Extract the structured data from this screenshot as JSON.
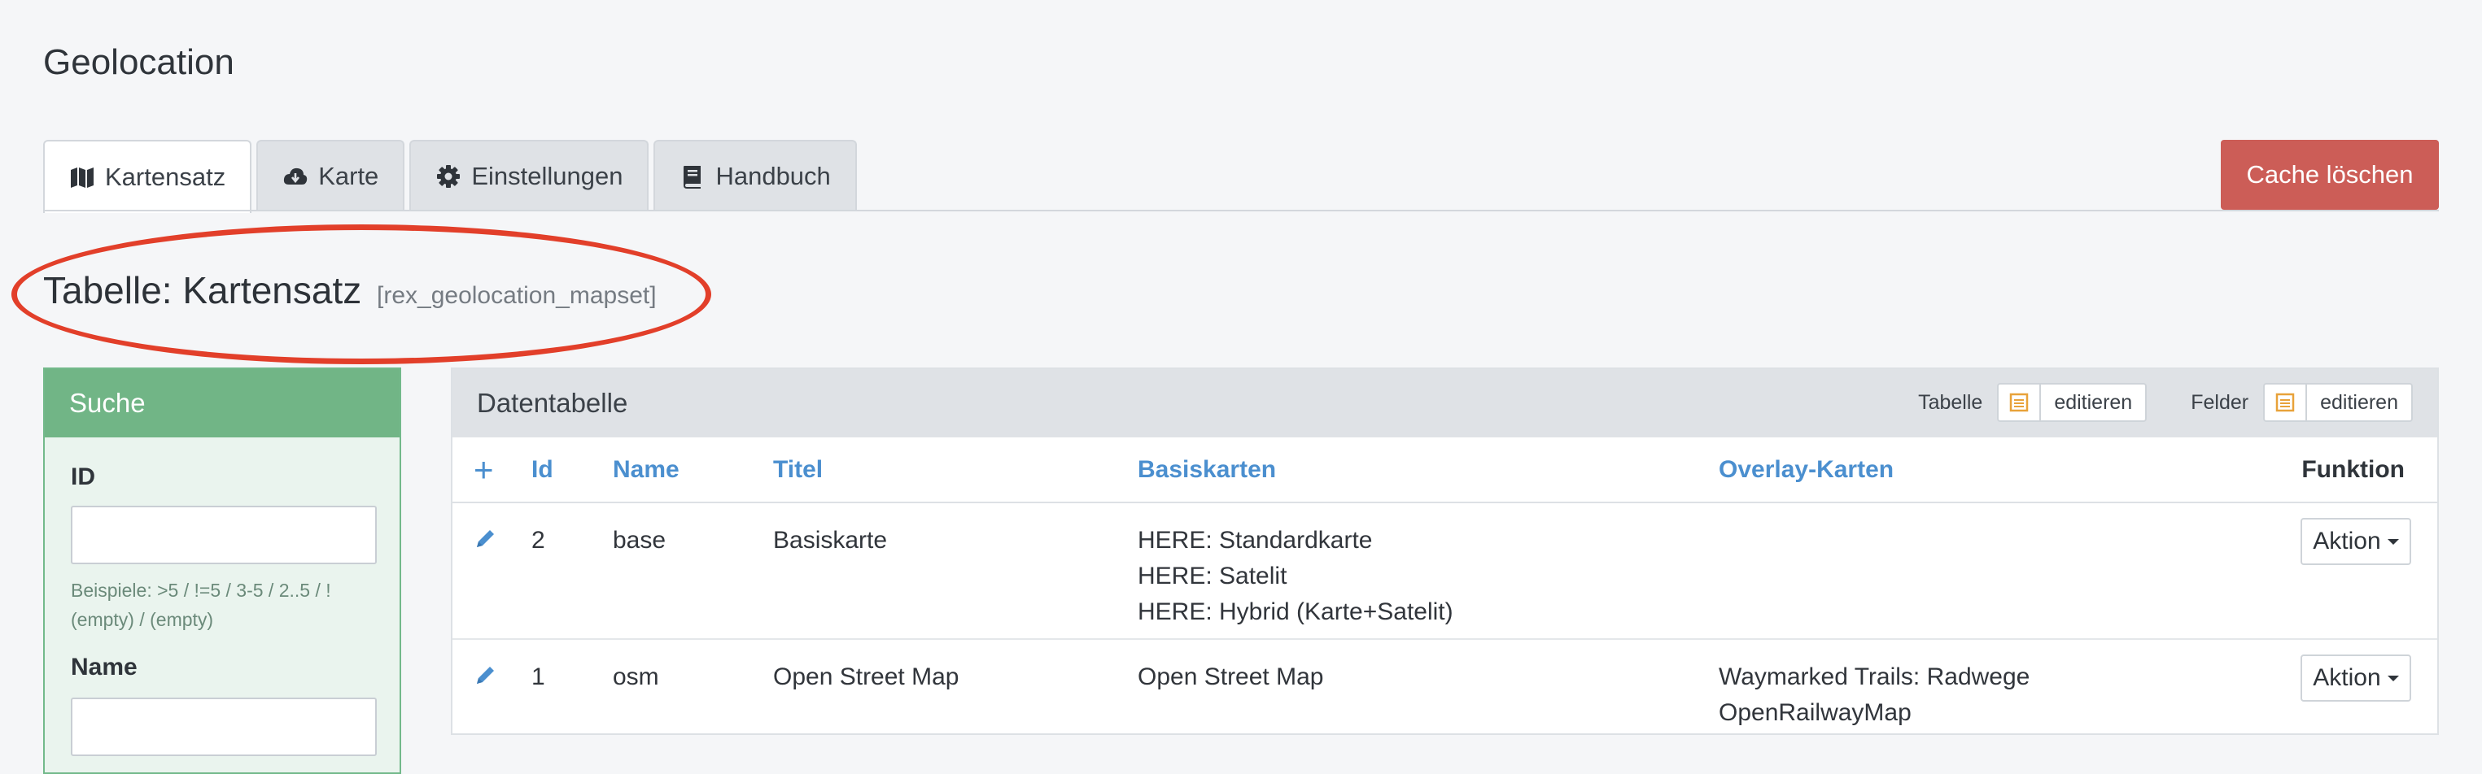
{
  "page": {
    "title": "Geolocation"
  },
  "tabs": [
    {
      "label": "Kartensatz",
      "icon": "map-icon",
      "active": true
    },
    {
      "label": "Karte",
      "icon": "cloud-download-icon",
      "active": false
    },
    {
      "label": "Einstellungen",
      "icon": "gear-icon",
      "active": false
    },
    {
      "label": "Handbuch",
      "icon": "book-icon",
      "active": false
    }
  ],
  "cache_button": {
    "label": "Cache löschen",
    "color": "#cc5d57"
  },
  "table_heading": {
    "title": "Tabelle: Kartensatz",
    "name": "[rex_geolocation_mapset]"
  },
  "search": {
    "title": "Suche",
    "fields": [
      {
        "label": "ID",
        "value": "",
        "hint": "Beispiele: >5 / !=5 / 3-5 / 2..5 / !(empty) / (empty)"
      },
      {
        "label": "Name",
        "value": ""
      }
    ]
  },
  "data_table": {
    "title": "Datentabelle",
    "tools": [
      {
        "label": "Tabelle",
        "button": "editieren"
      },
      {
        "label": "Felder",
        "button": "editieren"
      }
    ],
    "columns": [
      "+",
      "Id",
      "Name",
      "Titel",
      "Basiskarten",
      "Overlay-Karten",
      "Funktion"
    ],
    "rows": [
      {
        "id": "2",
        "name": "base",
        "titel": "Basiskarte",
        "basiskarten": [
          "HERE: Standardkarte",
          "HERE: Satelit",
          "HERE: Hybrid (Karte+Satelit)"
        ],
        "overlay": [],
        "action": "Aktion"
      },
      {
        "id": "1",
        "name": "osm",
        "titel": "Open Street Map",
        "basiskarten": [
          "Open Street Map"
        ],
        "overlay": [
          "Waymarked Trails: Radwege",
          "OpenRailwayMap"
        ],
        "action": "Aktion"
      }
    ]
  },
  "colors": {
    "accent_link": "#4b8fcf",
    "search_green": "#71b586",
    "annotation_red": "#e23f2a"
  }
}
